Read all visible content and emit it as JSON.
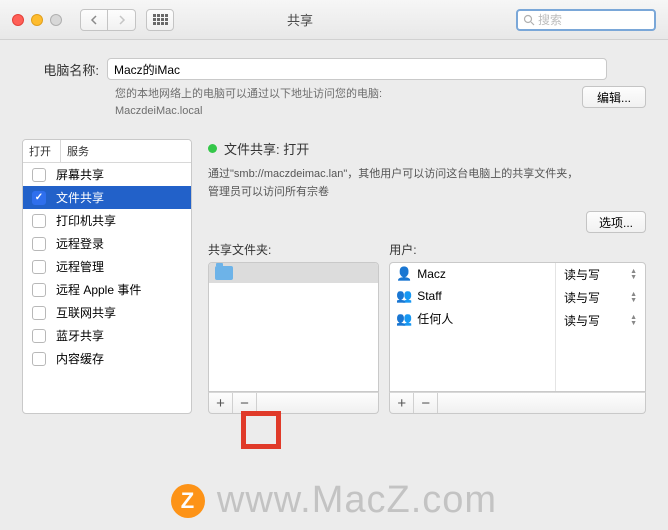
{
  "titlebar": {
    "title": "共享",
    "search_placeholder": "搜索"
  },
  "header": {
    "name_label": "电脑名称:",
    "name_value": "Macz的iMac",
    "desc_line1": "您的本地网络上的电脑可以通过以下地址访问您的电脑:",
    "desc_line2": "MaczdeiMac.local",
    "edit_button": "编辑..."
  },
  "sidebar": {
    "col_open": "打开",
    "col_service": "服务",
    "items": [
      {
        "label": "屏幕共享",
        "checked": false,
        "selected": false
      },
      {
        "label": "文件共享",
        "checked": true,
        "selected": true
      },
      {
        "label": "打印机共享",
        "checked": false,
        "selected": false
      },
      {
        "label": "远程登录",
        "checked": false,
        "selected": false
      },
      {
        "label": "远程管理",
        "checked": false,
        "selected": false
      },
      {
        "label": "远程 Apple 事件",
        "checked": false,
        "selected": false
      },
      {
        "label": "互联网共享",
        "checked": false,
        "selected": false
      },
      {
        "label": "蓝牙共享",
        "checked": false,
        "selected": false
      },
      {
        "label": "内容缓存",
        "checked": false,
        "selected": false
      }
    ]
  },
  "right": {
    "status_title": "文件共享: 打开",
    "status_desc": "通过\"smb://maczdeimac.lan\"，其他用户可以访问这台电脑上的共享文件夹，管理员可以访问所有宗卷",
    "options_button": "选项...",
    "folders_label": "共享文件夹:",
    "users_label": "用户:",
    "folders": [
      {
        "label": " ",
        "selected": true
      }
    ],
    "users": [
      {
        "icon": "person",
        "name": "Macz",
        "perm": "读与写"
      },
      {
        "icon": "people",
        "name": "Staff",
        "perm": "读与写"
      },
      {
        "icon": "people",
        "name": "任何人",
        "perm": "读与写"
      }
    ],
    "plus": "+",
    "minus": "−"
  },
  "watermark": {
    "z": "Z",
    "text": "www.MacZ.com"
  }
}
